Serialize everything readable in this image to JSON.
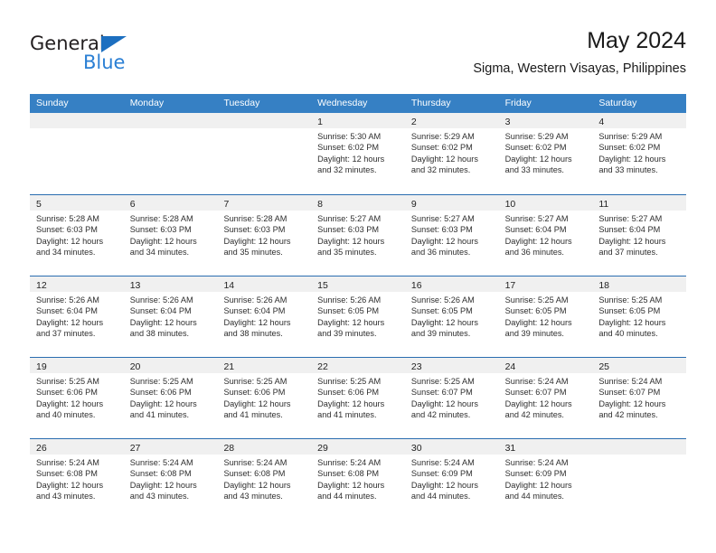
{
  "brand": {
    "name_top": "General",
    "name_bottom": "Blue",
    "color_dark": "#231f20",
    "color_blue": "#2a7fd4",
    "triangle_color": "#1c6fc0"
  },
  "header": {
    "title": "May 2024",
    "subtitle": "Sigma, Western Visayas, Philippines"
  },
  "theme": {
    "header_bg": "#3680c4",
    "header_text": "#ffffff",
    "row_separator": "#2a6db0",
    "day_bar_bg": "#f0f0f0",
    "cell_bg": "#ffffff",
    "body_text": "#2e2e2e"
  },
  "weekdays": [
    "Sunday",
    "Monday",
    "Tuesday",
    "Wednesday",
    "Thursday",
    "Friday",
    "Saturday"
  ],
  "weeks": [
    [
      {
        "day": "",
        "empty": true
      },
      {
        "day": "",
        "empty": true
      },
      {
        "day": "",
        "empty": true
      },
      {
        "day": "1",
        "sunrise": "Sunrise: 5:30 AM",
        "sunset": "Sunset: 6:02 PM",
        "daylight_1": "Daylight: 12 hours",
        "daylight_2": "and 32 minutes."
      },
      {
        "day": "2",
        "sunrise": "Sunrise: 5:29 AM",
        "sunset": "Sunset: 6:02 PM",
        "daylight_1": "Daylight: 12 hours",
        "daylight_2": "and 32 minutes."
      },
      {
        "day": "3",
        "sunrise": "Sunrise: 5:29 AM",
        "sunset": "Sunset: 6:02 PM",
        "daylight_1": "Daylight: 12 hours",
        "daylight_2": "and 33 minutes."
      },
      {
        "day": "4",
        "sunrise": "Sunrise: 5:29 AM",
        "sunset": "Sunset: 6:02 PM",
        "daylight_1": "Daylight: 12 hours",
        "daylight_2": "and 33 minutes."
      }
    ],
    [
      {
        "day": "5",
        "sunrise": "Sunrise: 5:28 AM",
        "sunset": "Sunset: 6:03 PM",
        "daylight_1": "Daylight: 12 hours",
        "daylight_2": "and 34 minutes."
      },
      {
        "day": "6",
        "sunrise": "Sunrise: 5:28 AM",
        "sunset": "Sunset: 6:03 PM",
        "daylight_1": "Daylight: 12 hours",
        "daylight_2": "and 34 minutes."
      },
      {
        "day": "7",
        "sunrise": "Sunrise: 5:28 AM",
        "sunset": "Sunset: 6:03 PM",
        "daylight_1": "Daylight: 12 hours",
        "daylight_2": "and 35 minutes."
      },
      {
        "day": "8",
        "sunrise": "Sunrise: 5:27 AM",
        "sunset": "Sunset: 6:03 PM",
        "daylight_1": "Daylight: 12 hours",
        "daylight_2": "and 35 minutes."
      },
      {
        "day": "9",
        "sunrise": "Sunrise: 5:27 AM",
        "sunset": "Sunset: 6:03 PM",
        "daylight_1": "Daylight: 12 hours",
        "daylight_2": "and 36 minutes."
      },
      {
        "day": "10",
        "sunrise": "Sunrise: 5:27 AM",
        "sunset": "Sunset: 6:04 PM",
        "daylight_1": "Daylight: 12 hours",
        "daylight_2": "and 36 minutes."
      },
      {
        "day": "11",
        "sunrise": "Sunrise: 5:27 AM",
        "sunset": "Sunset: 6:04 PM",
        "daylight_1": "Daylight: 12 hours",
        "daylight_2": "and 37 minutes."
      }
    ],
    [
      {
        "day": "12",
        "sunrise": "Sunrise: 5:26 AM",
        "sunset": "Sunset: 6:04 PM",
        "daylight_1": "Daylight: 12 hours",
        "daylight_2": "and 37 minutes."
      },
      {
        "day": "13",
        "sunrise": "Sunrise: 5:26 AM",
        "sunset": "Sunset: 6:04 PM",
        "daylight_1": "Daylight: 12 hours",
        "daylight_2": "and 38 minutes."
      },
      {
        "day": "14",
        "sunrise": "Sunrise: 5:26 AM",
        "sunset": "Sunset: 6:04 PM",
        "daylight_1": "Daylight: 12 hours",
        "daylight_2": "and 38 minutes."
      },
      {
        "day": "15",
        "sunrise": "Sunrise: 5:26 AM",
        "sunset": "Sunset: 6:05 PM",
        "daylight_1": "Daylight: 12 hours",
        "daylight_2": "and 39 minutes."
      },
      {
        "day": "16",
        "sunrise": "Sunrise: 5:26 AM",
        "sunset": "Sunset: 6:05 PM",
        "daylight_1": "Daylight: 12 hours",
        "daylight_2": "and 39 minutes."
      },
      {
        "day": "17",
        "sunrise": "Sunrise: 5:25 AM",
        "sunset": "Sunset: 6:05 PM",
        "daylight_1": "Daylight: 12 hours",
        "daylight_2": "and 39 minutes."
      },
      {
        "day": "18",
        "sunrise": "Sunrise: 5:25 AM",
        "sunset": "Sunset: 6:05 PM",
        "daylight_1": "Daylight: 12 hours",
        "daylight_2": "and 40 minutes."
      }
    ],
    [
      {
        "day": "19",
        "sunrise": "Sunrise: 5:25 AM",
        "sunset": "Sunset: 6:06 PM",
        "daylight_1": "Daylight: 12 hours",
        "daylight_2": "and 40 minutes."
      },
      {
        "day": "20",
        "sunrise": "Sunrise: 5:25 AM",
        "sunset": "Sunset: 6:06 PM",
        "daylight_1": "Daylight: 12 hours",
        "daylight_2": "and 41 minutes."
      },
      {
        "day": "21",
        "sunrise": "Sunrise: 5:25 AM",
        "sunset": "Sunset: 6:06 PM",
        "daylight_1": "Daylight: 12 hours",
        "daylight_2": "and 41 minutes."
      },
      {
        "day": "22",
        "sunrise": "Sunrise: 5:25 AM",
        "sunset": "Sunset: 6:06 PM",
        "daylight_1": "Daylight: 12 hours",
        "daylight_2": "and 41 minutes."
      },
      {
        "day": "23",
        "sunrise": "Sunrise: 5:25 AM",
        "sunset": "Sunset: 6:07 PM",
        "daylight_1": "Daylight: 12 hours",
        "daylight_2": "and 42 minutes."
      },
      {
        "day": "24",
        "sunrise": "Sunrise: 5:24 AM",
        "sunset": "Sunset: 6:07 PM",
        "daylight_1": "Daylight: 12 hours",
        "daylight_2": "and 42 minutes."
      },
      {
        "day": "25",
        "sunrise": "Sunrise: 5:24 AM",
        "sunset": "Sunset: 6:07 PM",
        "daylight_1": "Daylight: 12 hours",
        "daylight_2": "and 42 minutes."
      }
    ],
    [
      {
        "day": "26",
        "sunrise": "Sunrise: 5:24 AM",
        "sunset": "Sunset: 6:08 PM",
        "daylight_1": "Daylight: 12 hours",
        "daylight_2": "and 43 minutes."
      },
      {
        "day": "27",
        "sunrise": "Sunrise: 5:24 AM",
        "sunset": "Sunset: 6:08 PM",
        "daylight_1": "Daylight: 12 hours",
        "daylight_2": "and 43 minutes."
      },
      {
        "day": "28",
        "sunrise": "Sunrise: 5:24 AM",
        "sunset": "Sunset: 6:08 PM",
        "daylight_1": "Daylight: 12 hours",
        "daylight_2": "and 43 minutes."
      },
      {
        "day": "29",
        "sunrise": "Sunrise: 5:24 AM",
        "sunset": "Sunset: 6:08 PM",
        "daylight_1": "Daylight: 12 hours",
        "daylight_2": "and 44 minutes."
      },
      {
        "day": "30",
        "sunrise": "Sunrise: 5:24 AM",
        "sunset": "Sunset: 6:09 PM",
        "daylight_1": "Daylight: 12 hours",
        "daylight_2": "and 44 minutes."
      },
      {
        "day": "31",
        "sunrise": "Sunrise: 5:24 AM",
        "sunset": "Sunset: 6:09 PM",
        "daylight_1": "Daylight: 12 hours",
        "daylight_2": "and 44 minutes."
      },
      {
        "day": "",
        "empty": true
      }
    ]
  ]
}
